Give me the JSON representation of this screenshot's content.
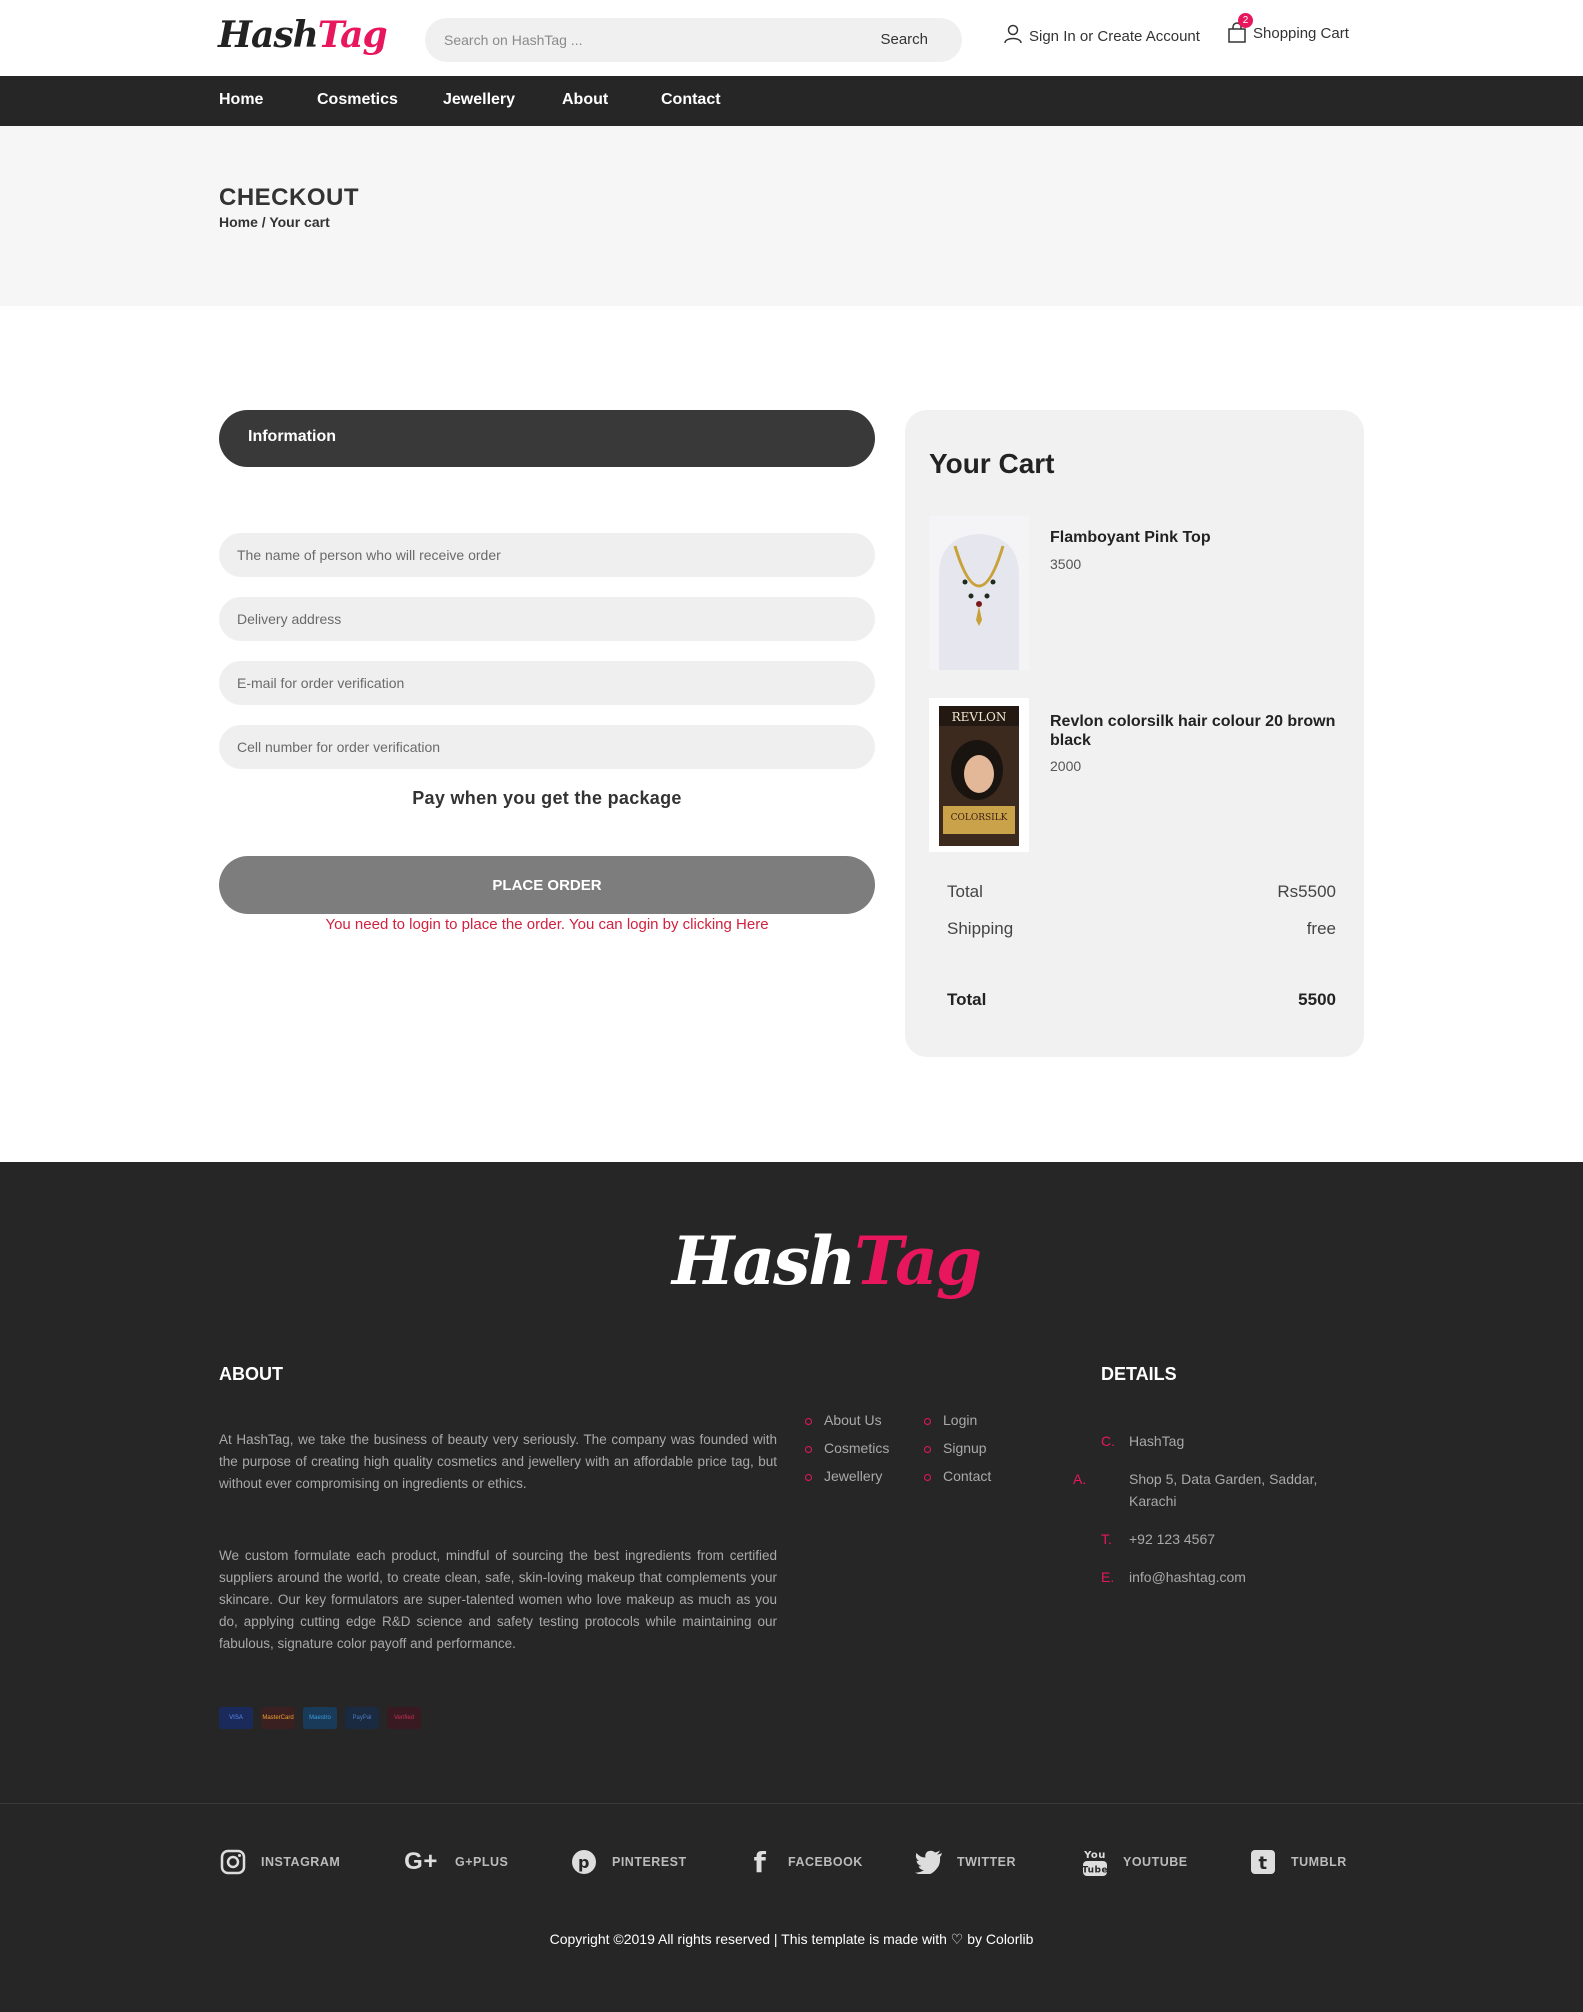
{
  "header": {
    "logo_hash": "Hash",
    "logo_tag": "Tag",
    "search_placeholder": "Search on HashTag ...",
    "search_button": "Search",
    "account_label": "Sign In or Create Account",
    "cart_label": "Shopping Cart",
    "cart_count": "2"
  },
  "nav": {
    "items": [
      {
        "label": "Home"
      },
      {
        "label": "Cosmetics"
      },
      {
        "label": "Jewellery"
      },
      {
        "label": "About"
      },
      {
        "label": "Contact"
      }
    ]
  },
  "page": {
    "title": "CHECKOUT",
    "breadcrumb": "Home / Your cart"
  },
  "form": {
    "section_title": "Information",
    "name_placeholder": "The name of person who will receive order",
    "address_placeholder": "Delivery address",
    "email_placeholder": "E-mail for order verification",
    "phone_placeholder": "Cell number for order verification",
    "payment_note": "Pay when you get the package",
    "place_order_label": "PLACE ORDER",
    "login_note": "You need to login to place the order. You can login by clicking Here"
  },
  "cart": {
    "title": "Your Cart",
    "items": [
      {
        "name": "Flamboyant Pink Top",
        "price": "3500",
        "image": "necklace-image"
      },
      {
        "name": "Revlon colorsilk hair colour 20 brown black",
        "price": "2000",
        "image": "hair-colour-box-image"
      }
    ],
    "total_label": "Total",
    "total_value": "Rs5500",
    "shipping_label": "Shipping",
    "shipping_value": "free",
    "grand_total_label": "Total",
    "grand_total_value": "5500"
  },
  "footer": {
    "logo_hash": "Hash",
    "logo_tag": "Tag",
    "about_title": "ABOUT",
    "about_p1": "At HashTag, we take the business of beauty very seriously. The company was founded with the purpose of creating high quality cosmetics and jewellery with an affordable price tag, but without ever compromising on ingredients or ethics.",
    "about_p2": "We custom formulate each product, mindful of sourcing the best ingredients from certified suppliers around the world, to create clean, safe, skin-loving makeup that complements your skincare. Our key formulators are super-talented women who love makeup as much as you do, applying cutting edge R&D science and safety testing protocols while maintaining our fabulous, signature color payoff and performance.",
    "links_col1": [
      "About Us",
      "Cosmetics",
      "Jewellery"
    ],
    "links_col2": [
      "Login",
      "Signup",
      "Contact"
    ],
    "details_title": "DETAILS",
    "details": [
      {
        "key": "C.",
        "value": "HashTag"
      },
      {
        "key": "A.",
        "value": "Shop 5, Data Garden, Saddar, Karachi"
      },
      {
        "key": "T.",
        "value": "+92 123 4567"
      },
      {
        "key": "E.",
        "value": "info@hashtag.com"
      }
    ],
    "payment_cards": [
      "VISA",
      "MasterCard",
      "Maestro",
      "PayPal",
      "Verified"
    ],
    "social": [
      {
        "label": "INSTAGRAM",
        "icon": "instagram-icon"
      },
      {
        "label": "G+PLUS",
        "icon": "google-plus-icon"
      },
      {
        "label": "PINTEREST",
        "icon": "pinterest-icon"
      },
      {
        "label": "FACEBOOK",
        "icon": "facebook-icon"
      },
      {
        "label": "TWITTER",
        "icon": "twitter-icon"
      },
      {
        "label": "YOUTUBE",
        "icon": "youtube-icon"
      },
      {
        "label": "TUMBLR",
        "icon": "tumblr-icon"
      }
    ],
    "copyright": "Copyright ©2019 All rights reserved | This template is made with ♡ by Colorlib"
  },
  "colors": {
    "accent": "#e8175d",
    "dark": "#262626",
    "error": "#d1213f"
  }
}
